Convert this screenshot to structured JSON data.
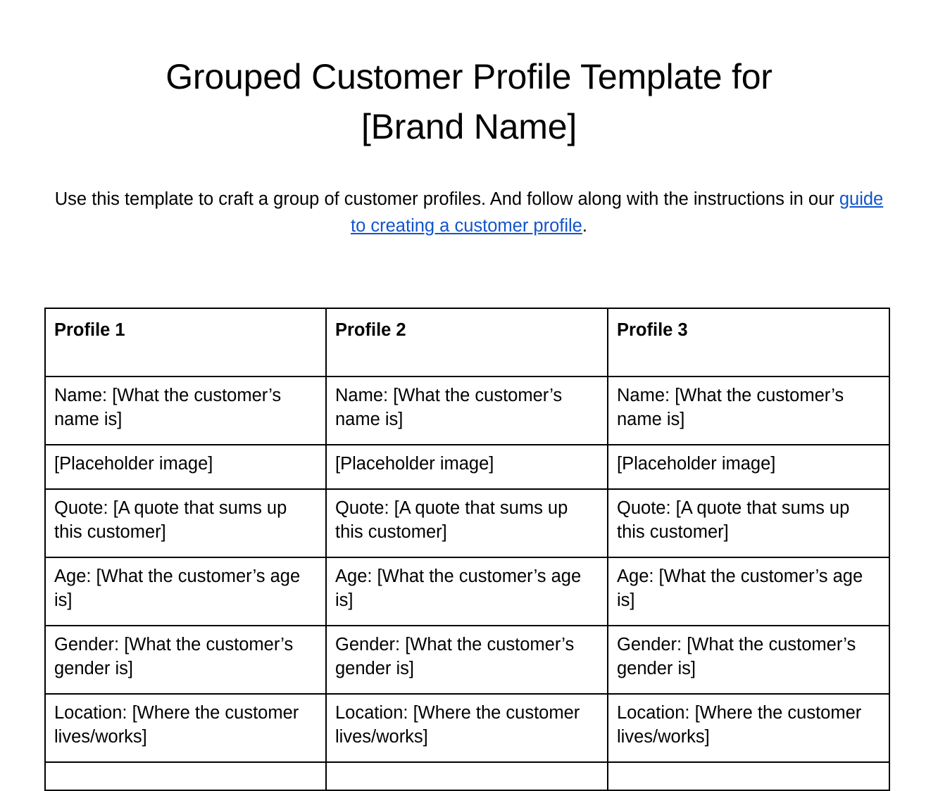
{
  "document": {
    "title_lines": [
      "Grouped Customer Profile Template for",
      "[Brand Name]"
    ],
    "intro": {
      "text_before": "Use this template to craft a group of customer profiles. And follow along with the instructions in our ",
      "link_text": "guide to creating a customer profile",
      "text_after": ".",
      "link_color": "#1155cc"
    }
  },
  "table": {
    "headers": [
      "Profile 1",
      "Profile 2",
      "Profile 3"
    ],
    "rows": [
      {
        "height": "tall",
        "cells": [
          "Name: [What the customer’s name is]",
          "Name: [What the customer’s name is]",
          "Name: [What the customer’s name is]"
        ]
      },
      {
        "height": "short",
        "cells": [
          "[Placeholder image]",
          "[Placeholder image]",
          "[Placeholder image]"
        ]
      },
      {
        "height": "tall",
        "cells": [
          "Quote: [A quote that sums up this customer]",
          "Quote: [A quote that sums up this customer]",
          "Quote: [A quote that sums up this customer]"
        ]
      },
      {
        "height": "tall",
        "cells": [
          "Age: [What the customer’s age is]",
          "Age: [What the customer’s age is]",
          "Age: [What the customer’s age is]"
        ]
      },
      {
        "height": "tall",
        "cells": [
          "Gender: [What the customer’s gender is]",
          "Gender: [What the customer’s gender is]",
          "Gender: [What the customer’s gender is]"
        ]
      },
      {
        "height": "tall",
        "cells": [
          "Location: [Where the customer lives/works]",
          "Location: [Where the customer lives/works]",
          "Location: [Where the customer lives/works]"
        ]
      },
      {
        "height": "empty",
        "cells": [
          "",
          "",
          ""
        ]
      }
    ]
  }
}
